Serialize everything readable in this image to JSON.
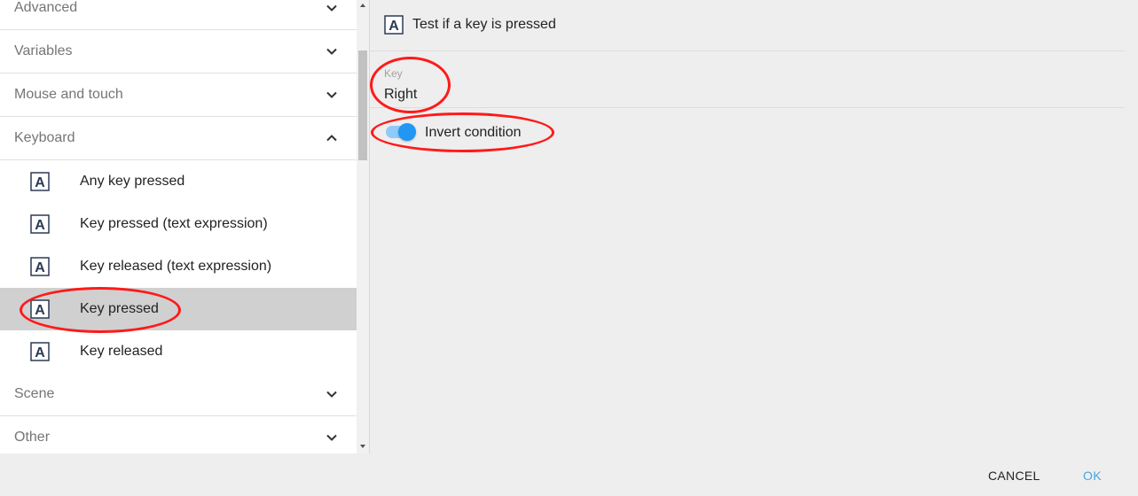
{
  "sidebar": {
    "categories": [
      {
        "label": "Advanced",
        "expanded": false
      },
      {
        "label": "Variables",
        "expanded": false
      },
      {
        "label": "Mouse and touch",
        "expanded": false
      },
      {
        "label": "Keyboard",
        "expanded": true
      },
      {
        "label": "Scene",
        "expanded": false
      },
      {
        "label": "Other",
        "expanded": false
      }
    ],
    "keyboard_items": [
      {
        "label": "Any key pressed",
        "selected": false
      },
      {
        "label": "Key pressed (text expression)",
        "selected": false
      },
      {
        "label": "Key released (text expression)",
        "selected": false
      },
      {
        "label": "Key pressed",
        "selected": true
      },
      {
        "label": "Key released",
        "selected": false
      }
    ]
  },
  "detail": {
    "title": "Test if a key is pressed",
    "key_field": {
      "label": "Key",
      "value": "Right"
    },
    "invert_condition": {
      "label": "Invert condition",
      "checked": true
    }
  },
  "footer": {
    "cancel_label": "CANCEL",
    "ok_label": "OK"
  },
  "colors": {
    "accent": "#2196f3",
    "annotation": "#ff1a1a",
    "ok_text": "#42a5e8",
    "selected_row": "#d0d0d0"
  },
  "icons": {
    "item_icon": "letter-a-keyboard-icon",
    "chevron_down": "chevron-down-icon",
    "chevron_up": "chevron-up-icon"
  }
}
